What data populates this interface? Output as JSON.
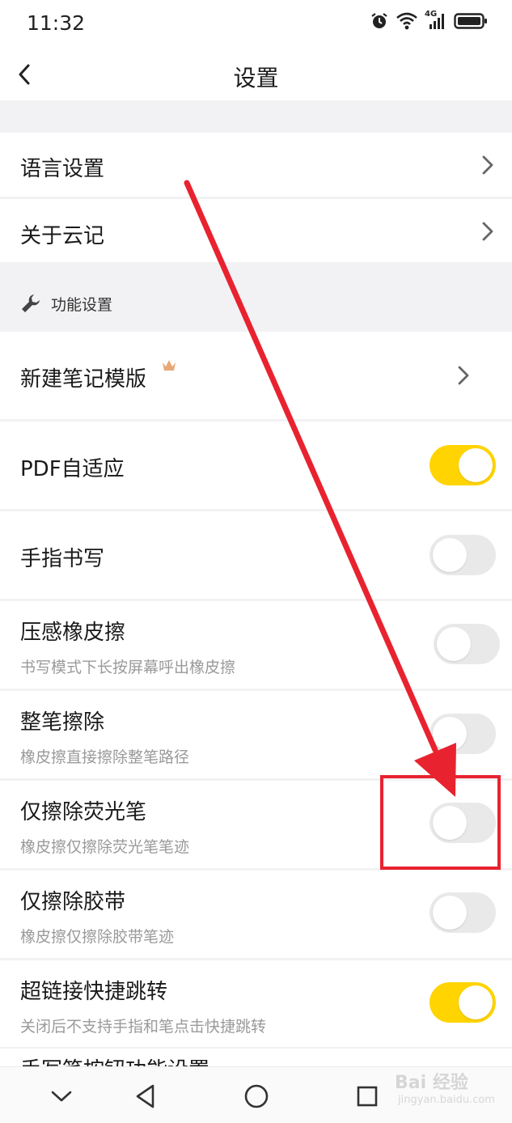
{
  "status_bar": {
    "time": "11:32",
    "network_label": "4G",
    "icons": [
      "alarm-icon",
      "wifi-icon",
      "cellular-signal-icon",
      "battery-icon"
    ]
  },
  "header": {
    "title": "设置",
    "back_icon": "back-chevron-icon"
  },
  "top_items": [
    {
      "label": "语言设置",
      "action": "chevron-right-icon"
    },
    {
      "label": "关于云记",
      "action": "chevron-right-icon"
    }
  ],
  "section": {
    "label": "功能设置",
    "icon": "wrench-icon"
  },
  "template_item": {
    "label": "新建笔记模版",
    "badge_icon": "crown-icon"
  },
  "toggle_items": [
    {
      "label": "PDF自适应",
      "sub": "",
      "on": true
    },
    {
      "label": "手指书写",
      "sub": "",
      "on": false
    },
    {
      "label": "压感橡皮擦",
      "sub": "书写模式下长按屏幕呼出橡皮擦",
      "on": false
    },
    {
      "label": "整笔擦除",
      "sub": "橡皮擦直接擦除整笔路径",
      "on": false
    },
    {
      "label": "仅擦除荧光笔",
      "sub": "橡皮擦仅擦除荧光笔笔迹",
      "on": false
    },
    {
      "label": "仅擦除胶带",
      "sub": "橡皮擦仅擦除胶带笔迹",
      "on": false
    },
    {
      "label": "超链接快捷跳转",
      "sub": "关闭后不支持手指和笔点击快捷跳转",
      "on": true
    }
  ],
  "peek_item": {
    "label": "手写笔按钮功能设置"
  },
  "colors": {
    "toggle_on": "#ffd400",
    "toggle_off": "#e9e9ea",
    "annotation": "#e8232f",
    "background_gap": "#f2f2f4"
  },
  "system_nav": [
    "collapse-icon",
    "back-triangle-icon",
    "home-circle-icon",
    "recents-square-icon"
  ],
  "watermark": {
    "main": "Bai 经验",
    "sub": "jingyan.baidu.com"
  }
}
